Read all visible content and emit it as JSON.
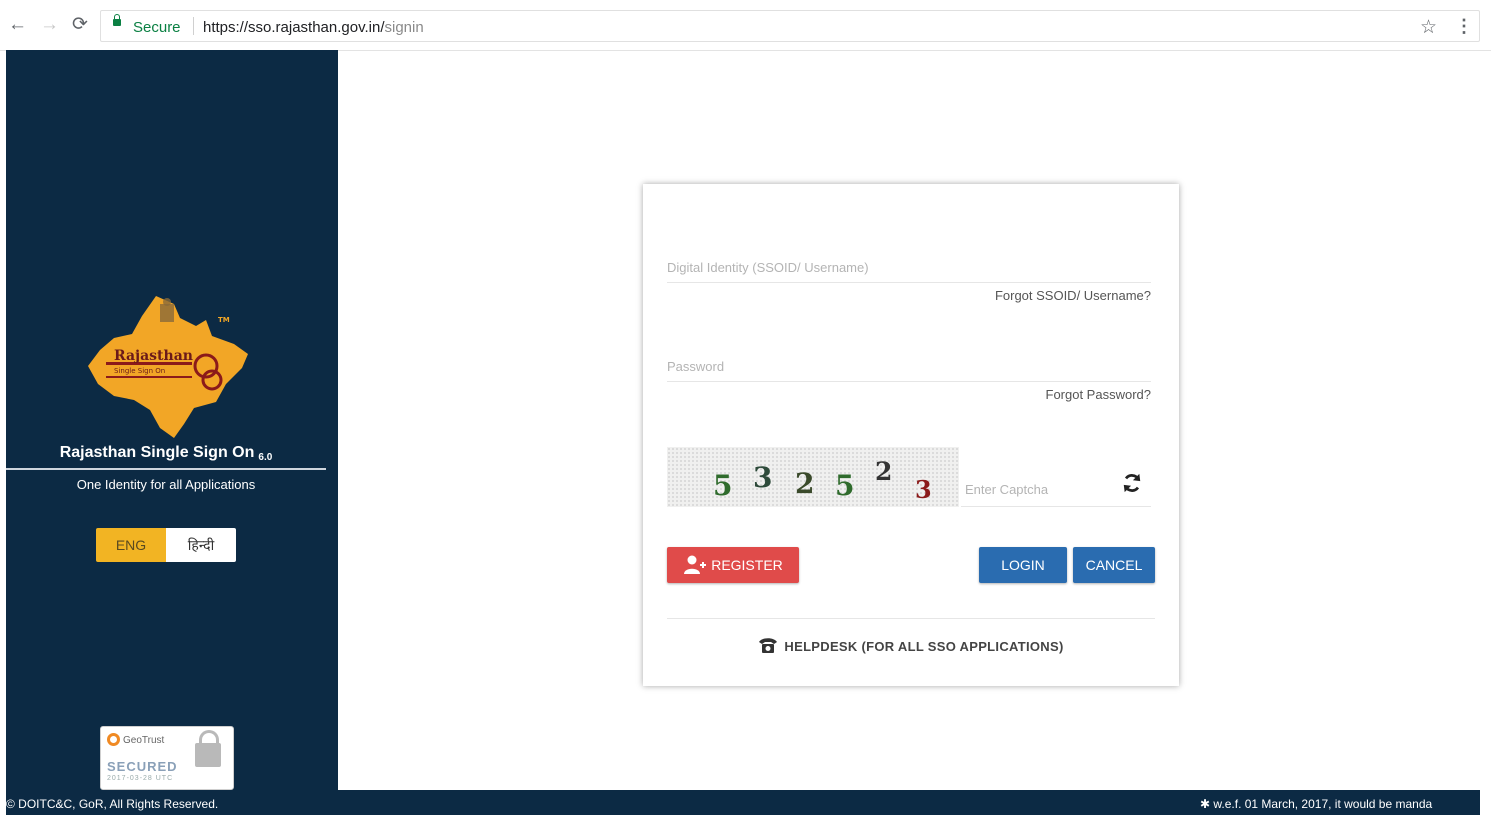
{
  "browser": {
    "secure_label": "Secure",
    "url_host": "https://sso.rajasthan.gov.in/",
    "url_path": "signin",
    "icons": [
      "back-icon",
      "forward-icon",
      "reload-icon",
      "lock-icon",
      "star-icon",
      "menu-icon"
    ]
  },
  "sidebar": {
    "logo_text": "Rajasthan",
    "logo_subtext": "Single Sign On",
    "logo_tm": "TM",
    "title": "Rajasthan Single Sign On",
    "version": "6.0",
    "tagline": "One Identity for all Applications",
    "lang_options": [
      "ENG",
      "हिन्दी"
    ],
    "selected_lang": "ENG",
    "seal": {
      "brand": "GeoTrust",
      "label": "SECURED",
      "date": "2017-03-28 UTC"
    }
  },
  "login": {
    "username_placeholder": "Digital Identity (SSOID/ Username)",
    "forgot_username": "Forgot SSOID/ Username?",
    "password_placeholder": "Password",
    "forgot_password": "Forgot Password?",
    "captcha_digits": [
      "5",
      "3",
      "2",
      "5",
      "2",
      "3"
    ],
    "captcha_placeholder": "Enter Captcha",
    "register_label": "REGISTER",
    "login_label": "LOGIN",
    "cancel_label": "CANCEL",
    "helpdesk_label": "HELPDESK (FOR ALL SSO APPLICATIONS)"
  },
  "footer": {
    "copyright": "© DOITC&C, GoR, All Rights Reserved.",
    "notice": "✱ w.e.f. 01 March, 2017, it would be manda"
  },
  "colors": {
    "sidebar_bg": "#0c2a44",
    "accent_yellow": "#f2b423",
    "register_red": "#e04b4a",
    "primary_blue": "#2a6cb0",
    "secure_green": "#0b8043"
  }
}
